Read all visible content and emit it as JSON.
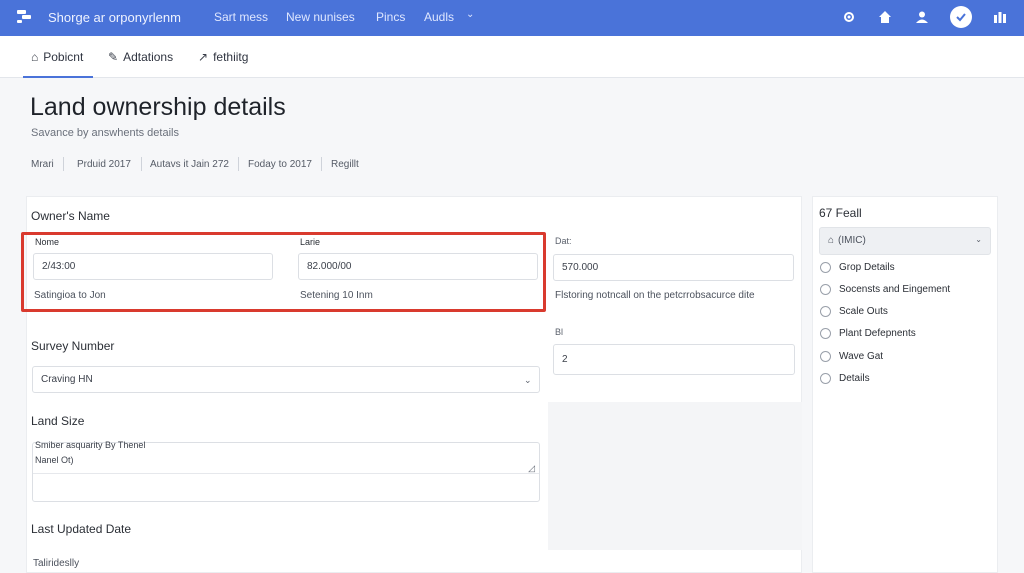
{
  "topbar": {
    "brand": "Shorge ar orponyrlenm",
    "nav": [
      "Sart mess",
      "New nunises",
      "Pincs",
      "Audls"
    ],
    "icons": [
      "gear-icon",
      "home-icon",
      "user-icon",
      "avatar-icon",
      "grid-icon"
    ]
  },
  "tabs": [
    {
      "label": "Pobicnt",
      "icon": "doc-icon"
    },
    {
      "label": "Adtations",
      "icon": "pin-icon"
    },
    {
      "label": "fethiitg",
      "icon": "link-icon"
    }
  ],
  "header": {
    "title": "Land ownership details",
    "subtitle": "Savance by answhents details"
  },
  "breadcrumb": [
    "Mrari",
    "Prduid 2017",
    "Autavs it Jain 272",
    "Foday to 2017",
    "Regillt"
  ],
  "form": {
    "owners_name": {
      "title": "Owner's Name",
      "name_label": "Nome",
      "name_value": "2/43:00",
      "name_hint": "Satingioa to Jon",
      "last_label": "Larie",
      "last_value": "82.000/00",
      "last_hint": "Setening 10 Inm",
      "date_label": "Dat:",
      "date_value": "570.000",
      "date_hint": "Flstoring notncall on the petcrrobsacurce dite"
    },
    "survey": {
      "title": "Survey Number",
      "select_value": "Craving HN",
      "bi_label": "Bl",
      "bi_value": "2"
    },
    "land_size": {
      "title": "Land Size",
      "line1": "Smiber asquarity By Thenel",
      "line2": "Nanel Ot)"
    },
    "last_updated": {
      "title": "Last Updated Date",
      "value": "Talirideslly"
    }
  },
  "side_panel": {
    "title": "67 Feall",
    "select_value": "(IMIC)",
    "options": [
      "Grop Details",
      "Socensts and Eingement",
      "Scale Outs",
      "Plant Defepnents",
      "Wave Gat",
      "Details"
    ]
  },
  "colors": {
    "accent": "#4a73d9",
    "highlight": "#d93a2e"
  }
}
